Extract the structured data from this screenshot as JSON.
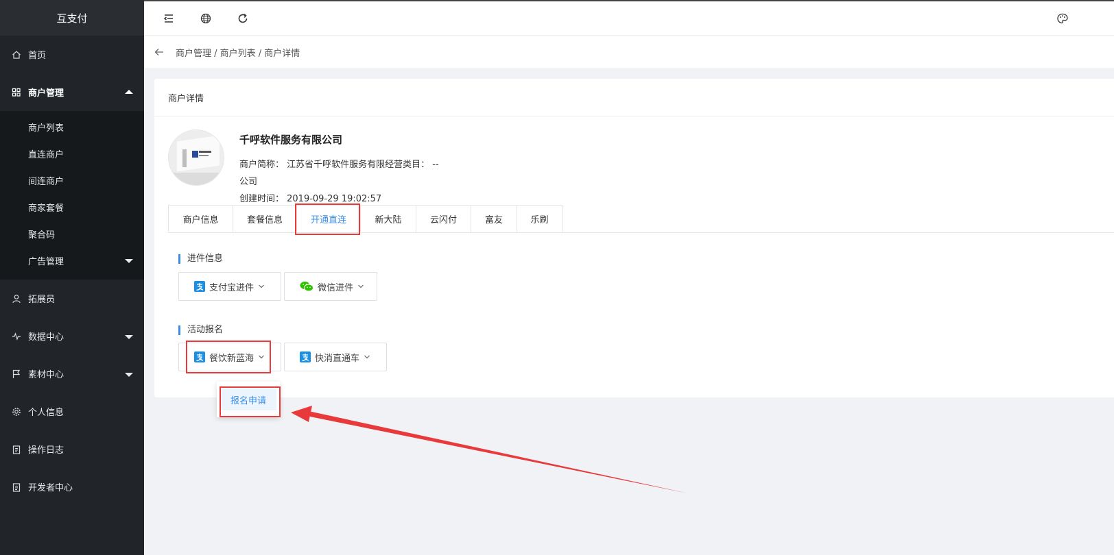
{
  "app": {
    "brand": "互支付"
  },
  "sidebar": {
    "items": [
      {
        "label": "首页",
        "icon": "home-icon"
      },
      {
        "label": "商户管理",
        "icon": "grid-icon",
        "open": true
      },
      {
        "label": "拓展员",
        "icon": "user-icon"
      },
      {
        "label": "数据中心",
        "icon": "pulse-icon"
      },
      {
        "label": "素材中心",
        "icon": "flag-icon"
      },
      {
        "label": "个人信息",
        "icon": "gear-icon"
      },
      {
        "label": "操作日志",
        "icon": "clipboard-icon"
      },
      {
        "label": "开发者中心",
        "icon": "clipboard-icon"
      }
    ],
    "submenu": [
      {
        "label": "商户列表"
      },
      {
        "label": "直连商户"
      },
      {
        "label": "间连商户"
      },
      {
        "label": "商家套餐"
      },
      {
        "label": "聚合码"
      },
      {
        "label": "广告管理"
      }
    ]
  },
  "topbar": {
    "icons": [
      "menu-fold-icon",
      "globe-icon",
      "refresh-icon",
      "palette-icon"
    ]
  },
  "breadcrumb": {
    "text": "商户管理 / 商户列表 / 商户详情"
  },
  "card": {
    "title": "商户详情",
    "company_name": "千呼软件服务有限公司",
    "short_name_line": "商户简称： 江苏省千呼软件服务有限经营类目： --",
    "short_name_wrap": "公司",
    "created_line": "创建时间： 2019-09-29 19:02:57"
  },
  "tabs": [
    {
      "label": "商户信息"
    },
    {
      "label": "套餐信息"
    },
    {
      "label": "开通直连",
      "active": true
    },
    {
      "label": "新大陆"
    },
    {
      "label": "云闪付"
    },
    {
      "label": "富友"
    },
    {
      "label": "乐刷"
    }
  ],
  "sections": {
    "onboarding": {
      "title": "进件信息",
      "buttons": [
        {
          "label": "支付宝进件",
          "icon": "alipay-icon"
        },
        {
          "label": "微信进件",
          "icon": "wechat-icon"
        }
      ]
    },
    "activity": {
      "title": "活动报名",
      "buttons": [
        {
          "label": "餐饮新蓝海",
          "icon": "alipay-icon"
        },
        {
          "label": "快消直通车",
          "icon": "alipay-icon"
        }
      ]
    }
  },
  "dropdown": {
    "item": "报名申请"
  },
  "colors": {
    "sidebar": "#212529",
    "accent": "#3a8ee6",
    "annotation": "#e8393b"
  }
}
